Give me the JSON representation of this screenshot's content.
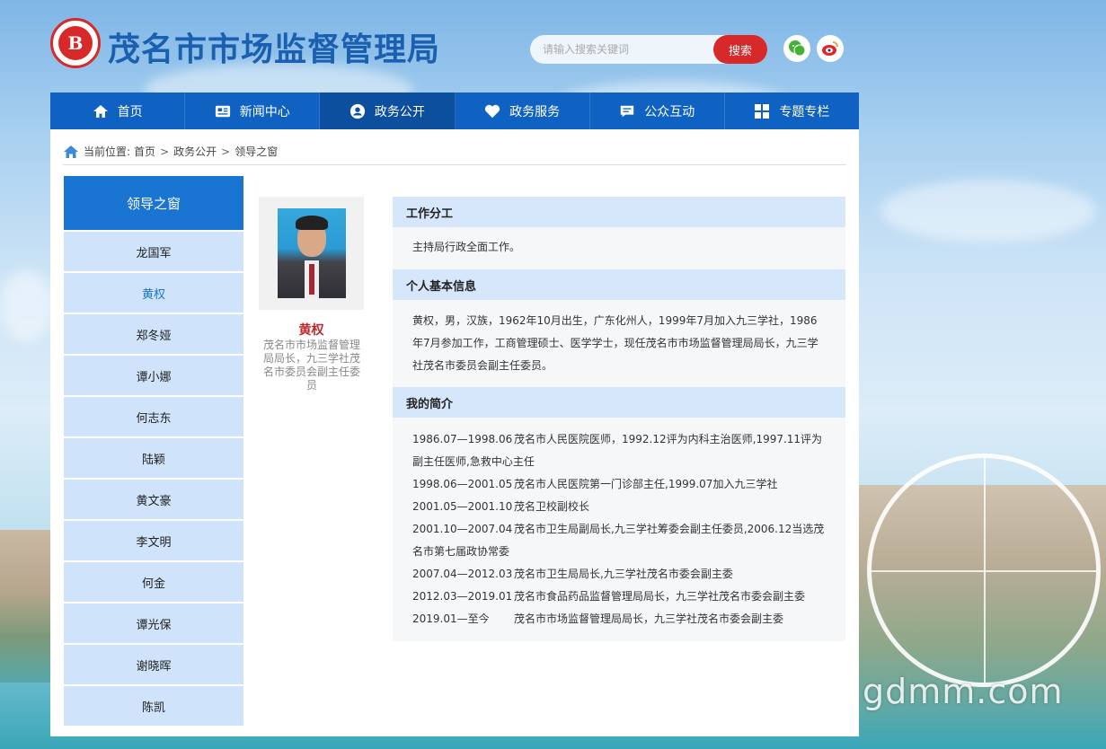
{
  "site": {
    "title": "茂名市市场监督管理局",
    "logo_text": "B",
    "watermark": "gdmm.com"
  },
  "search": {
    "placeholder": "请输入搜索关键词",
    "button_label": "搜索"
  },
  "nav": [
    {
      "label": "首页",
      "icon": "home-icon"
    },
    {
      "label": "新闻中心",
      "icon": "news-icon"
    },
    {
      "label": "政务公开",
      "icon": "user-circle-icon"
    },
    {
      "label": "政务服务",
      "icon": "heart-icon"
    },
    {
      "label": "公众互动",
      "icon": "chat-icon"
    },
    {
      "label": "专题专栏",
      "icon": "grid-icon"
    }
  ],
  "breadcrumb": {
    "prefix": "当前位置:",
    "items": [
      "首页",
      "政务公开",
      "领导之窗"
    ],
    "separator": ">"
  },
  "sidebar": {
    "heading": "领导之窗",
    "items": [
      "龙国军",
      "黄权",
      "郑冬娅",
      "谭小娜",
      "何志东",
      "陆颖",
      "黄文豪",
      "李文明",
      "何金",
      "谭光保",
      "谢晓晖",
      "陈凯"
    ],
    "active_index": 1
  },
  "person": {
    "name": "黄权",
    "title": "茂名市市场监督管理局局长，九三学社茂名市委员会副主任委员"
  },
  "sections": {
    "duty": {
      "heading": "工作分工",
      "text": "主持局行政全面工作。"
    },
    "basic": {
      "heading": "个人基本信息",
      "text": "黄权，男，汉族，1962年10月出生，广东化州人，1999年7月加入九三学社，1986年7月参加工作，工商管理硕士、医学学士，现任茂名市市场监督管理局局长，九三学社茂名市委员会副主任委员。"
    },
    "resume": {
      "heading": "我的简介",
      "entries": [
        {
          "date": "1986.07—1998.06",
          "text": "茂名市人民医院医师，1992.12评为内科主治医师,1997.11评为",
          "cont": "副主任医师,急救中心主任"
        },
        {
          "date": "1998.06—2001.05",
          "text": "茂名市人民医院第一门诊部主任,1999.07加入九三学社",
          "cont": ""
        },
        {
          "date": "2001.05—2001.10",
          "text": "茂名卫校副校长",
          "cont": ""
        },
        {
          "date": "2001.10—2007.04",
          "text": "茂名市卫生局副局长,九三学社筹委会副主任委员,2006.12当选茂",
          "cont": "名市第七届政协常委"
        },
        {
          "date": "2007.04—2012.03",
          "text": "茂名市卫生局局长,九三学社茂名市委会副主委",
          "cont": ""
        },
        {
          "date": "2012.03—2019.01",
          "text": "茂名市食品药品监督管理局局长，九三学社茂名市委会副主委",
          "cont": ""
        },
        {
          "date": "2019.01—至今",
          "text": "茂名市市场监督管理局局长，九三学社茂名市委会副主委",
          "cont": ""
        }
      ]
    }
  },
  "colors": {
    "brand_blue": "#0f62c2",
    "accent_red": "#d7282a",
    "sidebar_active_bg": "#1a74d2",
    "sidebar_item_bg": "#cfe3fa"
  }
}
